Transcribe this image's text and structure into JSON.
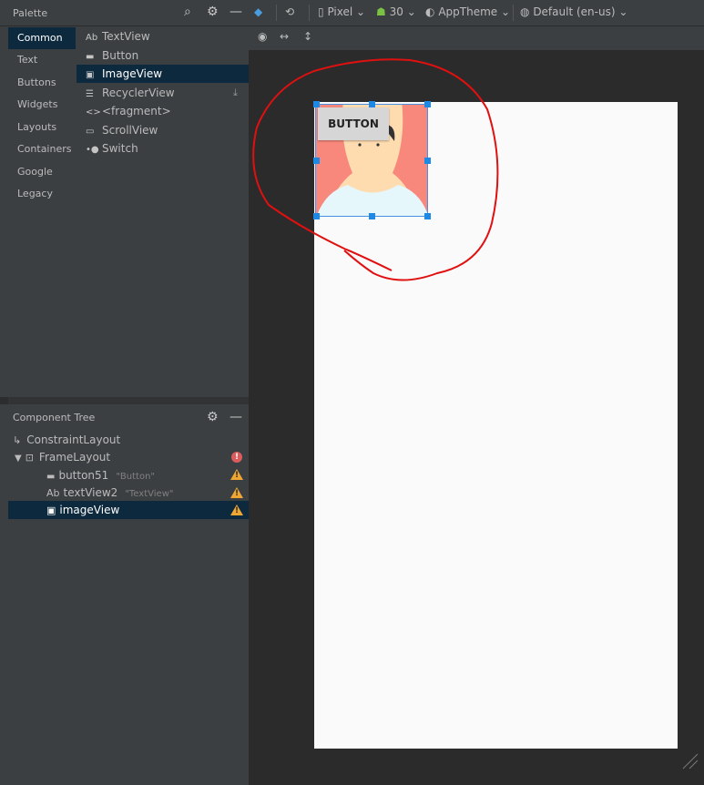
{
  "palette": {
    "title": "Palette",
    "categories": [
      "Common",
      "Text",
      "Buttons",
      "Widgets",
      "Layouts",
      "Containers",
      "Google",
      "Legacy"
    ],
    "selected_category": "Common",
    "items": [
      {
        "icon": "Ab",
        "label": "TextView"
      },
      {
        "icon": "button-icon",
        "label": "Button"
      },
      {
        "icon": "image-icon",
        "label": "ImageView"
      },
      {
        "icon": "list-icon",
        "label": "RecyclerView"
      },
      {
        "icon": "code-icon",
        "label": "<fragment>"
      },
      {
        "icon": "scroll-icon",
        "label": "ScrollView"
      },
      {
        "icon": "switch-icon",
        "label": "Switch"
      }
    ],
    "selected_item": "ImageView"
  },
  "component_tree": {
    "title": "Component Tree",
    "nodes": [
      {
        "label": "ConstraintLayout",
        "sub": ""
      },
      {
        "label": "FrameLayout",
        "sub": ""
      },
      {
        "label": "button51",
        "sub": "\"Button\""
      },
      {
        "label": "textView2",
        "sub": "\"TextView\""
      },
      {
        "label": "imageView",
        "sub": ""
      }
    ]
  },
  "toolbar": {
    "device": "Pixel",
    "api": "30",
    "theme": "AppTheme",
    "locale": "Default (en-us)"
  },
  "design": {
    "button_label": "BUTTON",
    "annotation_color": "#e01010"
  }
}
